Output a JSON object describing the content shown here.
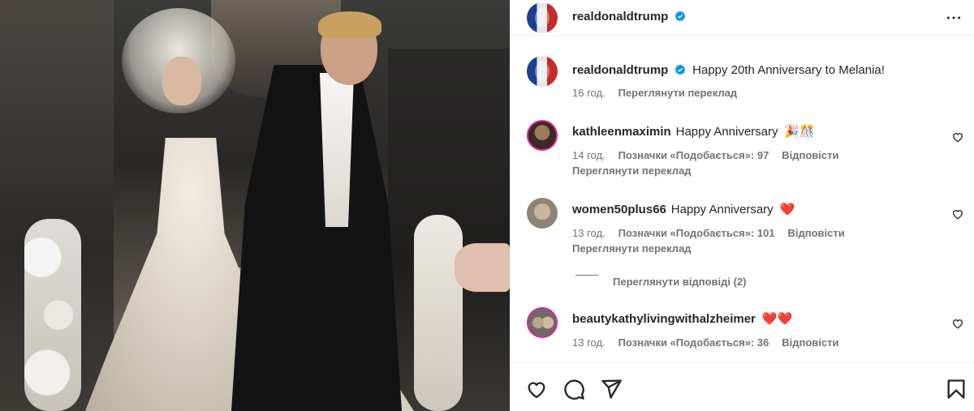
{
  "post": {
    "username": "realdonaldtrump",
    "caption": "Happy 20th Anniversary to Melania!",
    "time": "16 год.",
    "translate": "Переглянути переклад"
  },
  "comments": [
    {
      "username": "kathleenmaximin",
      "text": "Happy Anniversary",
      "emoji": "🎉🎊",
      "time": "14 год.",
      "likes": "Позначки «Подобається»: 97",
      "reply": "Відповісти",
      "translate": "Переглянути переклад"
    },
    {
      "username": "women50plus66",
      "text": "Happy Anniversary",
      "emoji": "❤️",
      "time": "13 год.",
      "likes": "Позначки «Подобається»: 101",
      "reply": "Відповісти",
      "translate": "Переглянути переклад",
      "view_replies": "Переглянути відповіді (2)"
    },
    {
      "username": "beautykathylivingwithalzheimer",
      "text": "",
      "emoji": "❤️❤️",
      "time": "13 год.",
      "likes": "Позначки «Подобається»: 36",
      "reply": "Відповісти"
    }
  ],
  "icons": {
    "like": "heart-icon",
    "comment": "comment-icon",
    "share": "send-icon",
    "save": "bookmark-icon",
    "more": "more-icon",
    "verified": "verified-badge-icon"
  },
  "colors": {
    "verified": "#0095f6",
    "heart": "#ed1c24",
    "text": "#262626",
    "muted": "#737373"
  }
}
